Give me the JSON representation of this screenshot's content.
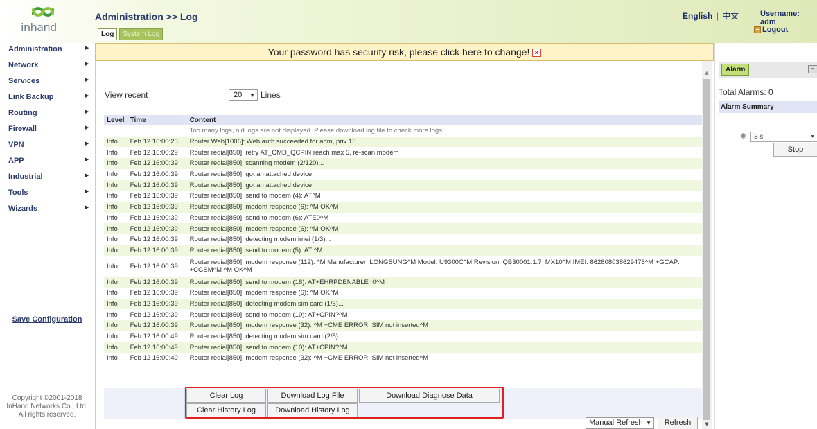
{
  "header": {
    "logo_text": "inhand",
    "page_title": "Administration >> Log",
    "tabs": [
      {
        "label": "Log",
        "active": true
      },
      {
        "label": "System Log",
        "active": false
      }
    ],
    "lang_en": "English",
    "lang_sep": "|",
    "lang_zh": "中文",
    "username": "Username: adm",
    "logout": "Logout"
  },
  "sidebar": {
    "items": [
      {
        "label": "Administration"
      },
      {
        "label": "Network"
      },
      {
        "label": "Services"
      },
      {
        "label": "Link Backup"
      },
      {
        "label": "Routing"
      },
      {
        "label": "Firewall"
      },
      {
        "label": "VPN"
      },
      {
        "label": "APP"
      },
      {
        "label": "Industrial"
      },
      {
        "label": "Tools"
      },
      {
        "label": "Wizards"
      }
    ],
    "save_config": "Save Configuration",
    "copyright_1": "Copyright ©2001-2018",
    "copyright_2": "InHand Networks Co., Ltd.",
    "copyright_3": "All rights reserved."
  },
  "warning": {
    "text": "Your password has security risk, please click here to change!",
    "close": "×"
  },
  "view": {
    "label": "View recent",
    "lines_value": "20",
    "lines_label": "Lines"
  },
  "table": {
    "headers": [
      "Level",
      "Time",
      "Content"
    ],
    "notice": "Too many logs, old logs are not displayed. Please download log file to check more logs!",
    "rows": [
      {
        "level": "Info",
        "time": "Feb 12 16:00:25",
        "content": "Router Web[1006]: Web auth succeeded for adm, priv 15"
      },
      {
        "level": "Info",
        "time": "Feb 12 16:00:29",
        "content": "Router redial[850]: retry AT_CMD_QCPIN reach max 5, re-scan modem"
      },
      {
        "level": "Info",
        "time": "Feb 12 16:00:39",
        "content": "Router redial[850]: scanning modem (2/120)..."
      },
      {
        "level": "Info",
        "time": "Feb 12 16:00:39",
        "content": "Router redial[850]: got an attached device"
      },
      {
        "level": "Info",
        "time": "Feb 12 16:00:39",
        "content": "Router redial[850]: got an attached device"
      },
      {
        "level": "Info",
        "time": "Feb 12 16:00:39",
        "content": "Router redial[850]: send to modem (4): AT^M"
      },
      {
        "level": "Info",
        "time": "Feb 12 16:00:39",
        "content": "Router redial[850]: modem response (6): ^M OK^M"
      },
      {
        "level": "Info",
        "time": "Feb 12 16:00:39",
        "content": "Router redial[850]: send to modem (6): ATE0^M"
      },
      {
        "level": "Info",
        "time": "Feb 12 16:00:39",
        "content": "Router redial[850]: modem response (6): ^M OK^M"
      },
      {
        "level": "Info",
        "time": "Feb 12 16:00:39",
        "content": "Router redial[850]: detecting modem imei (1/3)..."
      },
      {
        "level": "Info",
        "time": "Feb 12 16:00:39",
        "content": "Router redial[850]: send to modem (5): ATI^M"
      },
      {
        "level": "Info",
        "time": "Feb 12 16:00:39",
        "content": "Router redial[850]: modem response (112): ^M Manufacturer: LONGSUNG^M Model: U9300C^M Revision: QB30001.1.7_MX10^M IMEI: 862808038629476^M +GCAP: +CGSM^M ^M OK^M"
      },
      {
        "level": "Info",
        "time": "Feb 12 16:00:39",
        "content": "Router redial[850]: send to modem (18): AT+EHRPDENABLE=0^M"
      },
      {
        "level": "Info",
        "time": "Feb 12 16:00:39",
        "content": "Router redial[850]: modem response (6): ^M OK^M"
      },
      {
        "level": "Info",
        "time": "Feb 12 16:00:39",
        "content": "Router redial[850]: detecting modem sim card (1/5)..."
      },
      {
        "level": "Info",
        "time": "Feb 12 16:00:39",
        "content": "Router redial[850]: send to modem (10): AT+CPIN?^M"
      },
      {
        "level": "Info",
        "time": "Feb 12 16:00:39",
        "content": "Router redial[850]: modem response (32): ^M +CME ERROR: SIM not inserted^M"
      },
      {
        "level": "Info",
        "time": "Feb 12 16:00:49",
        "content": "Router redial[850]: detecting modem sim card (2/5)..."
      },
      {
        "level": "Info",
        "time": "Feb 12 16:00:49",
        "content": "Router redial[850]: send to modem (10): AT+CPIN?^M"
      },
      {
        "level": "Info",
        "time": "Feb 12 16:00:49",
        "content": "Router redial[850]: modem response (32): ^M +CME ERROR: SIM not inserted^M"
      }
    ]
  },
  "buttons": {
    "clear_log": "Clear Log",
    "download_log_file": "Download Log File",
    "download_diagnose_data": "Download Diagnose Data",
    "clear_history_log": "Clear History Log",
    "download_history_log": "Download History Log"
  },
  "bottom": {
    "refresh_mode": "Manual Refresh",
    "refresh_button": "Refresh"
  },
  "alarm": {
    "tab": "Alarm",
    "collapse": "–",
    "total": "Total Alarms: 0",
    "summary": "Alarm Summary",
    "interval": "3 s",
    "stop": "Stop"
  },
  "colors": {
    "highlight_border": "#e02020",
    "row_alt": "#eff8df",
    "header_row": "#e0e4f5",
    "warning_bg": "#fff3c7"
  }
}
